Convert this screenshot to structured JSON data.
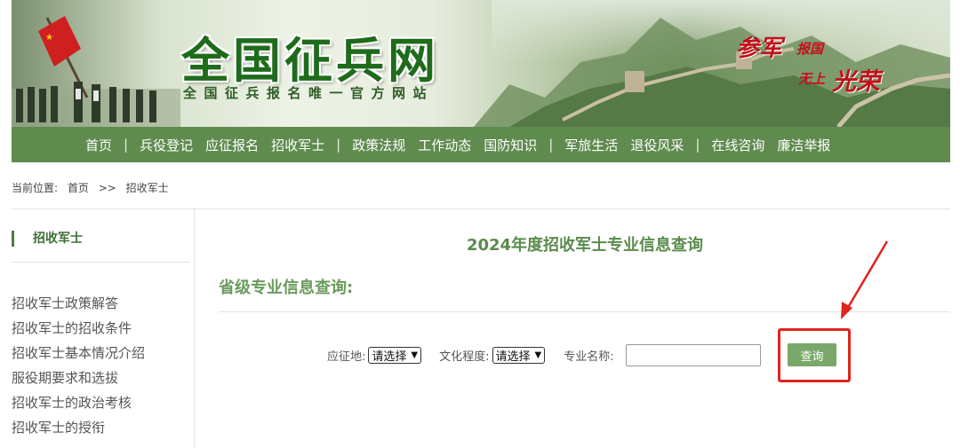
{
  "banner": {
    "title": "全国征兵网",
    "subtitle": "全国征兵报名唯一官方网站",
    "slogan": {
      "part1": "参军",
      "part2": "报国",
      "part3": "无上",
      "part4": "光荣"
    }
  },
  "nav": {
    "items": [
      "首页",
      "兵役登记",
      "应征报名",
      "招收军士",
      "政策法规",
      "工作动态",
      "国防知识",
      "军旅生活",
      "退役风采",
      "在线咨询",
      "廉洁举报"
    ],
    "separator": "|"
  },
  "breadcrumb": {
    "label": "当前位置:",
    "home": "首页",
    "arrow": ">>",
    "current": "招收军士"
  },
  "sidebar": {
    "title": "招收军士",
    "items": [
      "招收军士政策解答",
      "招收军士的招收条件",
      "招收军士基本情况介绍",
      "服役期要求和选拔",
      "招收军士的政治考核",
      "招收军士的授衔"
    ]
  },
  "main": {
    "title": "2024年度招收军士专业信息查询",
    "section_title": "省级专业信息查询:",
    "query": {
      "region_label": "应征地:",
      "region_value": "请选择",
      "education_label": "文化程度:",
      "education_value": "请选择",
      "major_label": "专业名称:",
      "major_value": "",
      "button_label": "查询"
    }
  },
  "colors": {
    "nav_bg": "#5f8b4f",
    "title_green": "#5a8b4c",
    "button_green": "#7aa86a",
    "highlight_red": "#e0231c"
  }
}
